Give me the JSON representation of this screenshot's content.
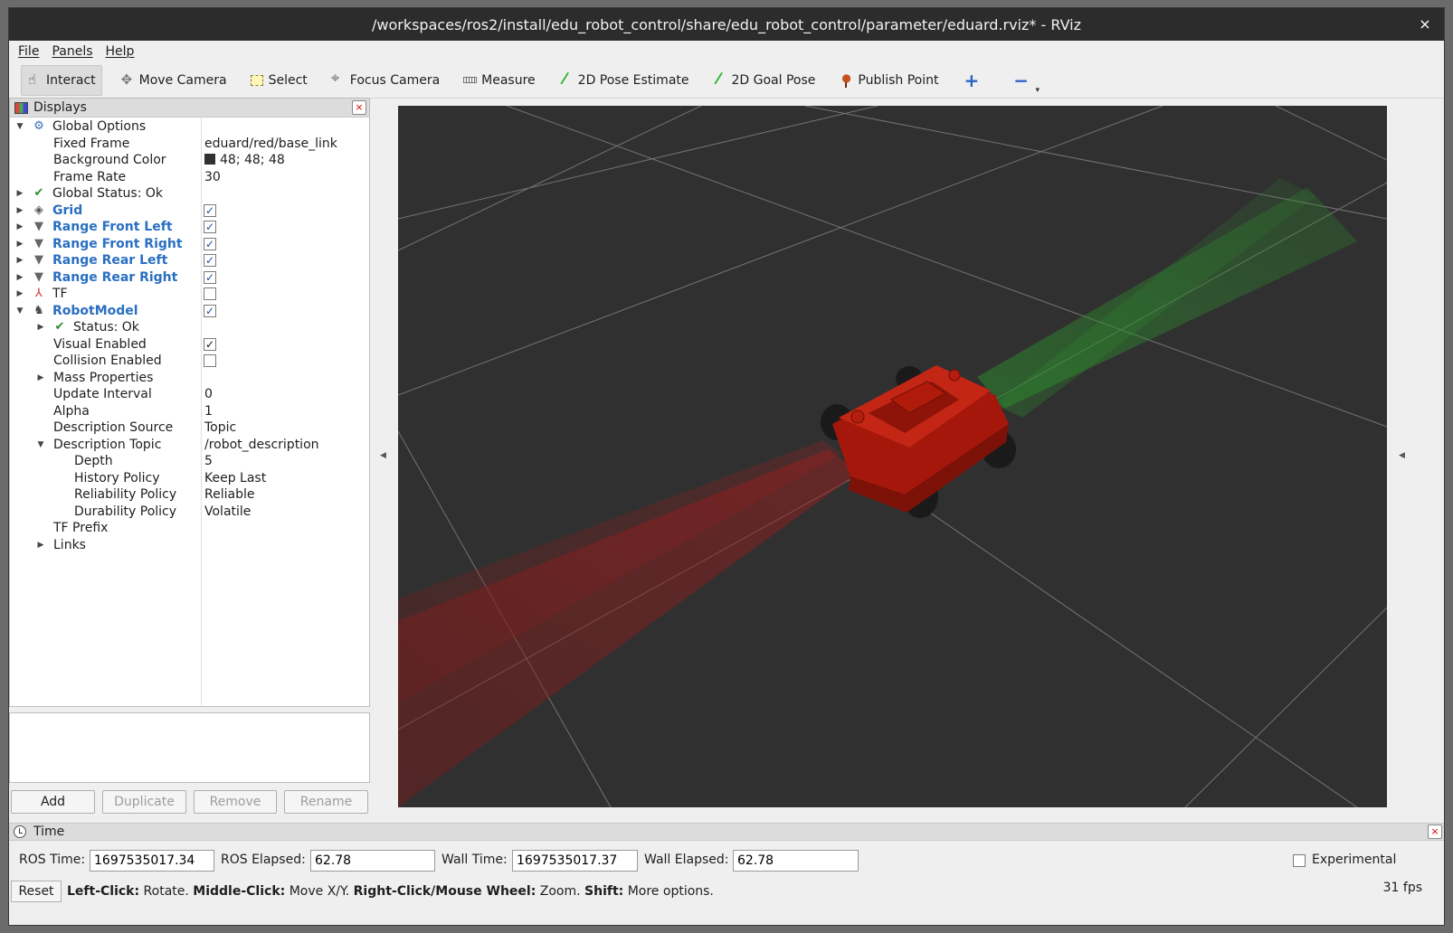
{
  "window": {
    "title": "/workspaces/ros2/install/edu_robot_control/share/edu_robot_control/parameter/eduard.rviz* - RViz",
    "close": "×"
  },
  "menu": [
    "File",
    "Panels",
    "Help"
  ],
  "toolbar": {
    "interact": "Interact",
    "move_camera": "Move Camera",
    "select": "Select",
    "focus_camera": "Focus Camera",
    "measure": "Measure",
    "pose_estimate": "2D Pose Estimate",
    "goal_pose": "2D Goal Pose",
    "publish_point": "Publish Point",
    "plus": "+",
    "minus": "−",
    "dropdown": "▾"
  },
  "displays": {
    "title": "Displays",
    "close": "×",
    "rows": [
      {
        "arrow": "▼",
        "name": "Global Options",
        "value": ""
      },
      {
        "arrow": "",
        "name": "Fixed Frame",
        "value": "eduard/red/base_link"
      },
      {
        "arrow": "",
        "name": "Background Color",
        "value": "48; 48; 48"
      },
      {
        "arrow": "",
        "name": "Frame Rate",
        "value": "30"
      },
      {
        "arrow": "▶",
        "name": "Global Status: Ok",
        "value": ""
      },
      {
        "arrow": "▶",
        "name": "Grid",
        "value": ""
      },
      {
        "arrow": "▶",
        "name": "Range Front Left",
        "value": ""
      },
      {
        "arrow": "▶",
        "name": "Range Front Right",
        "value": ""
      },
      {
        "arrow": "▶",
        "name": "Range Rear Left",
        "value": ""
      },
      {
        "arrow": "▶",
        "name": "Range Rear Right",
        "value": ""
      },
      {
        "arrow": "▶",
        "name": "TF",
        "value": ""
      },
      {
        "arrow": "▼",
        "name": "RobotModel",
        "value": ""
      },
      {
        "arrow": "▶",
        "name": "Status: Ok",
        "value": ""
      },
      {
        "arrow": "",
        "name": "Visual Enabled",
        "value": ""
      },
      {
        "arrow": "",
        "name": "Collision Enabled",
        "value": ""
      },
      {
        "arrow": "▶",
        "name": "Mass Properties",
        "value": ""
      },
      {
        "arrow": "",
        "name": "Update Interval",
        "value": "0"
      },
      {
        "arrow": "",
        "name": "Alpha",
        "value": "1"
      },
      {
        "arrow": "",
        "name": "Description Source",
        "value": "Topic"
      },
      {
        "arrow": "▼",
        "name": "Description Topic",
        "value": "/robot_description"
      },
      {
        "arrow": "",
        "name": "Depth",
        "value": "5"
      },
      {
        "arrow": "",
        "name": "History Policy",
        "value": "Keep Last"
      },
      {
        "arrow": "",
        "name": "Reliability Policy",
        "value": "Reliable"
      },
      {
        "arrow": "",
        "name": "Durability Policy",
        "value": "Volatile"
      },
      {
        "arrow": "",
        "name": "TF Prefix",
        "value": ""
      },
      {
        "arrow": "▶",
        "name": "Links",
        "value": ""
      }
    ],
    "checkbox_states": {
      "grid": true,
      "range_front_left": true,
      "range_front_right": true,
      "range_rear_left": true,
      "range_rear_right": true,
      "tf": false,
      "robot_model": true,
      "visual_enabled": true,
      "collision_enabled": false
    },
    "check_glyph": "✓",
    "background_color_hex": "#303030"
  },
  "buttons": {
    "add": "Add",
    "duplicate": "Duplicate",
    "remove": "Remove",
    "rename": "Rename"
  },
  "time": {
    "title": "Time",
    "close": "×",
    "ros_time_label": "ROS Time:",
    "ros_time": "1697535017.34",
    "ros_elapsed_label": "ROS Elapsed:",
    "ros_elapsed": "62.78",
    "wall_time_label": "Wall Time:",
    "wall_time": "1697535017.37",
    "wall_elapsed_label": "Wall Elapsed:",
    "wall_elapsed": "62.78",
    "experimental": "Experimental"
  },
  "status": {
    "reset": "Reset",
    "hint_parts": [
      {
        "b": "Left-Click:",
        "t": " Rotate. "
      },
      {
        "b": "Middle-Click:",
        "t": " Move X/Y. "
      },
      {
        "b": "Right-Click/Mouse Wheel:",
        "t": " Zoom. "
      },
      {
        "b": "Shift:",
        "t": " More options."
      }
    ],
    "fps": "31 fps"
  },
  "colors": {
    "robot": "#b01a0a",
    "range_green": "#2d8a2d",
    "range_red": "#9a1f1f",
    "viewport_bg": "#303030",
    "link_blue": "#2a6fc1"
  }
}
